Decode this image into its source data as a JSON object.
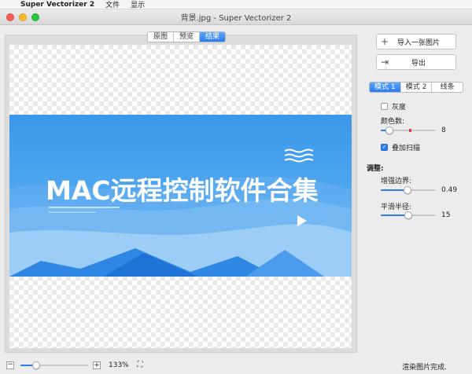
{
  "menubar": {
    "apple": "",
    "app": "Super Vectorizer 2",
    "menus": [
      "文件",
      "显示"
    ]
  },
  "window": {
    "title": "背景.jpg - Super Vectorizer 2"
  },
  "view_tabs": [
    "原图",
    "预览",
    "结果"
  ],
  "image": {
    "title": "MAC远程控制软件合集"
  },
  "actions": {
    "import": "导入一张图片",
    "export": "导出"
  },
  "mode_tabs": [
    "模式 1",
    "模式 2",
    "线条"
  ],
  "options": {
    "grayscale": "灰度",
    "colors_label": "颜色数:",
    "colors_value": "8",
    "colors_level": 0.1,
    "overlay_scan": "叠加扫描"
  },
  "adjust": {
    "heading": "调整:",
    "edge_label": "增强边界:",
    "edge_value": "0.49",
    "edge_level": 0.49,
    "smooth_label": "平滑半径:",
    "smooth_value": "15",
    "smooth_level": 0.5
  },
  "bottom": {
    "zoom": "133%",
    "zoom_level": 0.2,
    "status": "渲染图片完成."
  },
  "icons": {
    "import": "plus-icon",
    "export": "export-icon",
    "fit": "fit-screen-icon"
  },
  "colors": {
    "accent": "#2c7bf0",
    "image_blue": "#3b97ea"
  }
}
